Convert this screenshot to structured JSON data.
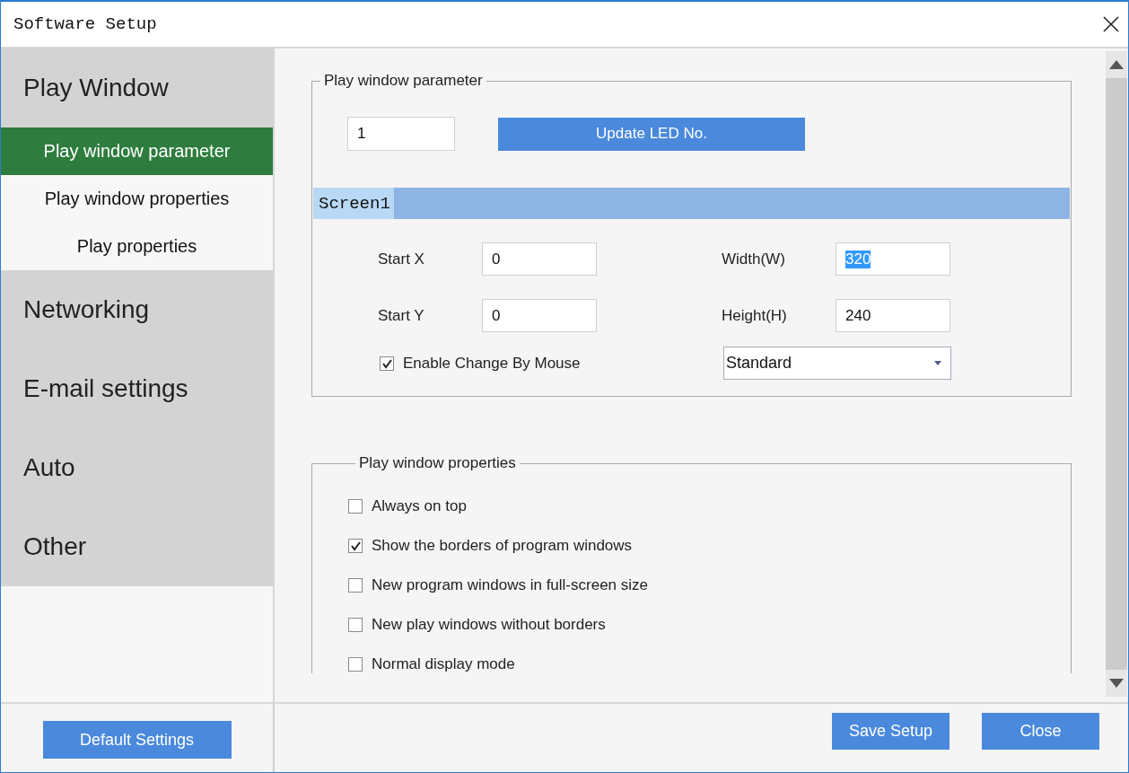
{
  "window": {
    "title": "Software Setup"
  },
  "sidebar": {
    "groups": [
      {
        "label": "Play Window",
        "children": [
          {
            "label": "Play window parameter",
            "selected": true
          },
          {
            "label": "Play window properties",
            "selected": false
          },
          {
            "label": "Play properties",
            "selected": false
          }
        ]
      },
      {
        "label": "Networking"
      },
      {
        "label": "E-mail settings"
      },
      {
        "label": "Auto"
      },
      {
        "label": "Other"
      }
    ]
  },
  "play_window_parameter": {
    "title": "Play window parameter",
    "led_number": "1",
    "update_button": "Update LED No.",
    "screens": [
      {
        "label": "Screen1",
        "selected": true
      }
    ],
    "fields": [
      {
        "label": "Start X",
        "value": "0",
        "highlighted": false
      },
      {
        "label": "Width(W)",
        "value": "320",
        "highlighted": true
      },
      {
        "label": "Start Y",
        "value": "0",
        "highlighted": false
      },
      {
        "label": "Height(H)",
        "value": "240",
        "highlighted": false
      }
    ],
    "enable_change_by_mouse": {
      "label": "Enable Change By Mouse",
      "checked": true
    },
    "mode": {
      "value": "Standard"
    }
  },
  "play_window_properties": {
    "title": "Play window properties",
    "options": [
      {
        "label": "Always on top",
        "checked": false
      },
      {
        "label": "Show the borders of program windows",
        "checked": true
      },
      {
        "label": "New program windows in full-screen size",
        "checked": false
      },
      {
        "label": "New play windows without borders",
        "checked": false
      },
      {
        "label": "Normal display mode",
        "checked": false
      }
    ]
  },
  "footer": {
    "default_button": "Default Settings",
    "buttons": [
      "Save Setup",
      "Close"
    ]
  }
}
